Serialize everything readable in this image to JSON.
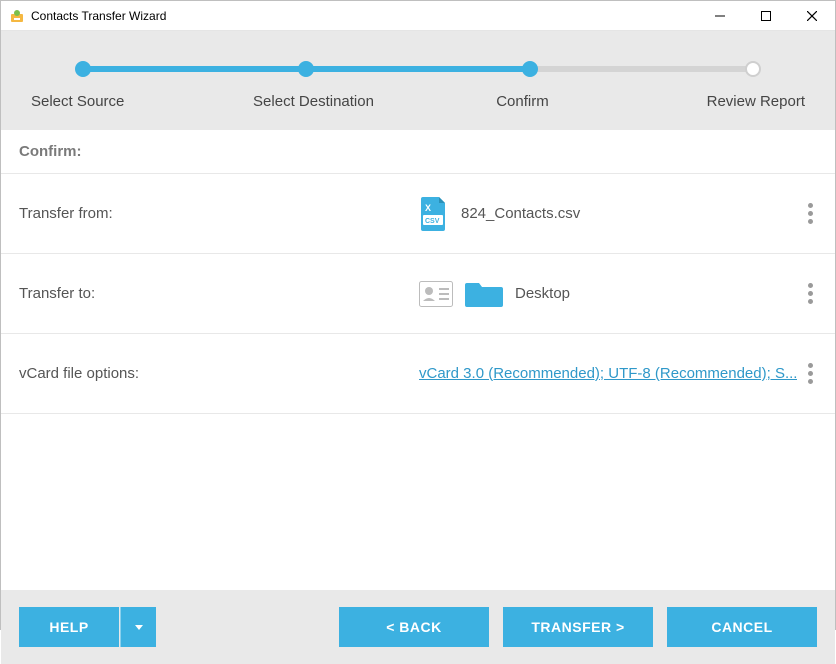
{
  "window": {
    "title": "Contacts Transfer Wizard"
  },
  "stepper": {
    "steps": [
      "Select Source",
      "Select Destination",
      "Confirm",
      "Review Report"
    ],
    "current": 2
  },
  "section": {
    "header": "Confirm:"
  },
  "rows": {
    "from": {
      "label": "Transfer from:",
      "value": "824_Contacts.csv"
    },
    "to": {
      "label": "Transfer to:",
      "value": "Desktop"
    },
    "options": {
      "label": "vCard file options:",
      "value": "vCard 3.0 (Recommended); UTF-8 (Recommended); S..."
    }
  },
  "buttons": {
    "help": "HELP",
    "back": "< BACK",
    "transfer": "TRANSFER >",
    "cancel": "CANCEL"
  }
}
